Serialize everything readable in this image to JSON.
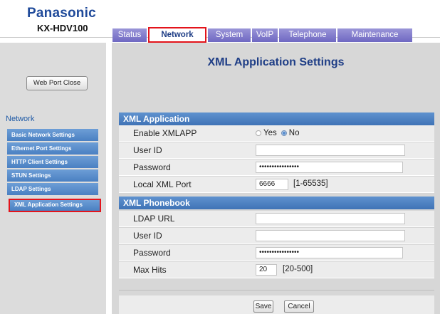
{
  "header": {
    "brand": "Panasonic",
    "model": "KX-HDV100"
  },
  "tabs": [
    {
      "label": "Status"
    },
    {
      "label": "Network"
    },
    {
      "label": "System"
    },
    {
      "label": "VoIP"
    },
    {
      "label": "Telephone"
    },
    {
      "label": "Maintenance"
    }
  ],
  "active_tab": "Network",
  "sidebar": {
    "web_port_button": "Web Port Close",
    "heading": "Network",
    "items": [
      {
        "label": "Basic Network Settings"
      },
      {
        "label": "Ethernet Port Settings"
      },
      {
        "label": "HTTP Client Settings"
      },
      {
        "label": "STUN Settings"
      },
      {
        "label": "LDAP Settings"
      },
      {
        "label": "XML Application Settings"
      }
    ],
    "selected": "XML Application Settings"
  },
  "page": {
    "title": "XML Application Settings"
  },
  "xml_application": {
    "section_title": "XML Application",
    "enable_label": "Enable XMLAPP",
    "yes_label": "Yes",
    "no_label": "No",
    "selected": "No",
    "user_id_label": "User ID",
    "user_id_value": "",
    "password_label": "Password",
    "password_value": "••••••••••••••••",
    "port_label": "Local XML Port",
    "port_value": "6666",
    "port_range": "[1-65535]"
  },
  "xml_phonebook": {
    "section_title": "XML Phonebook",
    "ldap_url_label": "LDAP URL",
    "ldap_url_value": "",
    "user_id_label": "User ID",
    "user_id_value": "",
    "password_label": "Password",
    "password_value": "••••••••••••••••",
    "max_hits_label": "Max Hits",
    "max_hits_value": "20",
    "max_hits_range": "[20-500]"
  },
  "actions": {
    "save": "Save",
    "cancel": "Cancel"
  }
}
